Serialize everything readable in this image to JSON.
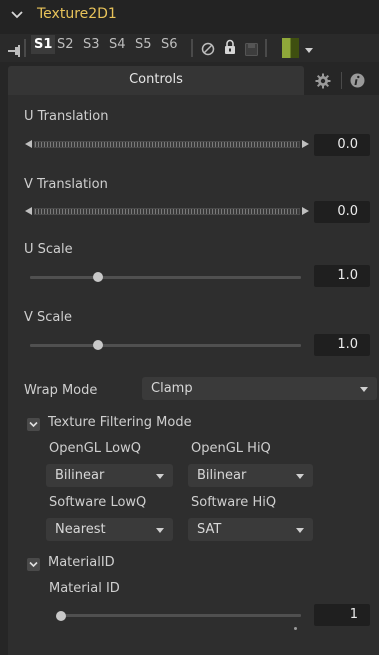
{
  "header": {
    "title": "Texture2D1"
  },
  "toolbar": {
    "slots": [
      "S1",
      "S2",
      "S3",
      "S4",
      "S5",
      "S6"
    ],
    "active_slot": "S1",
    "color_swatch": "#556b1c"
  },
  "tabs": {
    "controls_label": "Controls"
  },
  "controls": {
    "u_translation": {
      "label": "U Translation",
      "value": "0.0"
    },
    "v_translation": {
      "label": "V Translation",
      "value": "0.0"
    },
    "u_scale": {
      "label": "U Scale",
      "value": "1.0",
      "position": 0.2
    },
    "v_scale": {
      "label": "V Scale",
      "value": "1.0",
      "position": 0.2
    },
    "wrap_mode": {
      "label": "Wrap Mode",
      "value": "Clamp"
    },
    "texture_filtering": {
      "label": "Texture Filtering Mode",
      "opengl_lowq": {
        "label": "OpenGL LowQ",
        "value": "Bilinear"
      },
      "opengl_hiq": {
        "label": "OpenGL HiQ",
        "value": "Bilinear"
      },
      "software_lowq": {
        "label": "Software LowQ",
        "value": "Nearest"
      },
      "software_hiq": {
        "label": "Software HiQ",
        "value": "SAT"
      }
    },
    "material_id_group": {
      "label": "MaterialID",
      "material_id": {
        "label": "Material ID",
        "value": "1",
        "position": 0.0
      }
    }
  },
  "colors": {
    "title": "#e8c35a",
    "background": "#2e2e2e",
    "panel": "#262626"
  },
  "icons": [
    "chevron-down-icon",
    "pin-icon",
    "disable-icon",
    "lock-icon",
    "save-icon",
    "color-swatch",
    "gear-icon",
    "info-icon",
    "checkbox-icon"
  ]
}
